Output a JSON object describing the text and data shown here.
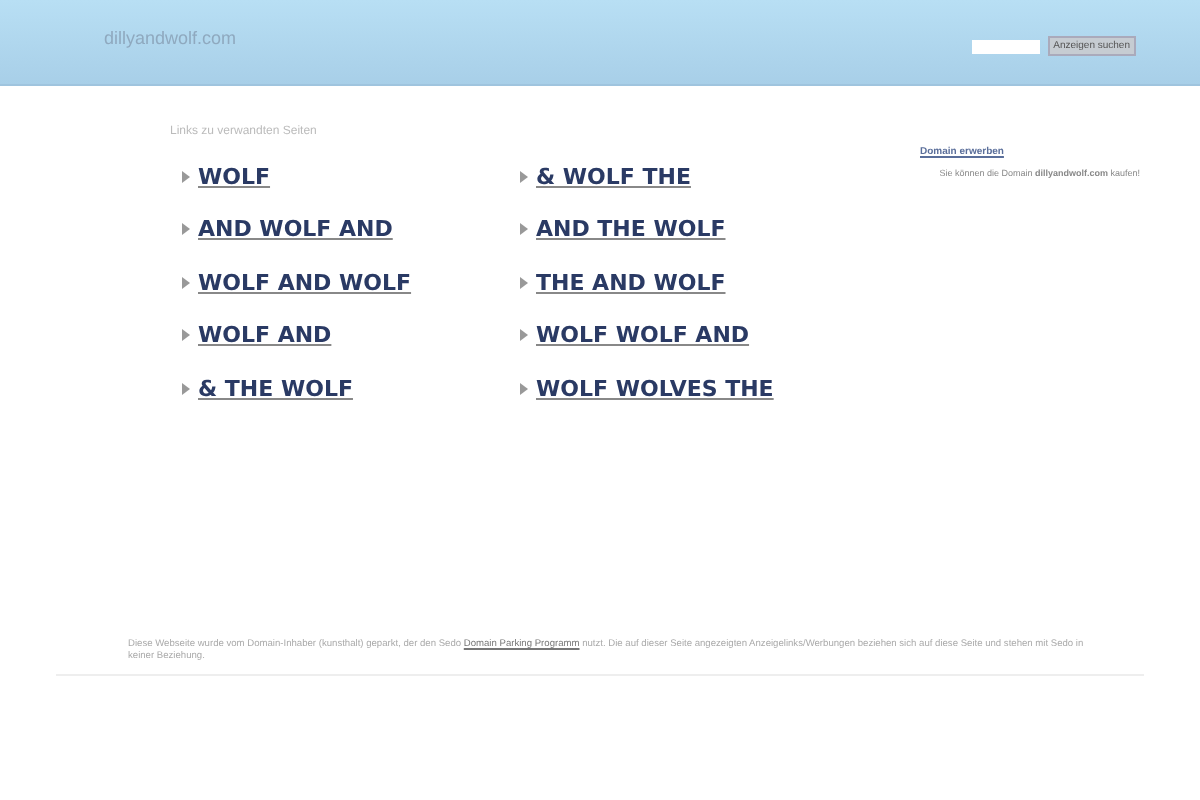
{
  "header": {
    "site_name": "dillyandwolf.com",
    "search_button": "Anzeigen suchen"
  },
  "related": {
    "heading": "Links zu verwandten Seiten",
    "columns": [
      [
        "WOLF",
        "AND WOLF AND",
        "WOLF AND WOLF",
        "WOLF AND",
        "& THE WOLF"
      ],
      [
        "& WOLF THE",
        "AND THE WOLF",
        "THE AND WOLF",
        "WOLF WOLF AND",
        "WOLF WOLVES THE"
      ]
    ]
  },
  "sidebar": {
    "title": "Domain erwerben",
    "text": "Sie können die Domain **dillyandwolf.com** kaufen!"
  },
  "footer": {
    "before": "Diese Webseite wurde vom Domain-Inhaber (kunsthalt) geparkt, der den Sedo",
    "link": "Domain Parking Programm",
    "after": "nutzt. Die auf dieser Seite angezeigten Anzeigelinks/Werbungen beziehen sich auf diese Seite und stehen mit Sedo in keiner Beziehung."
  }
}
